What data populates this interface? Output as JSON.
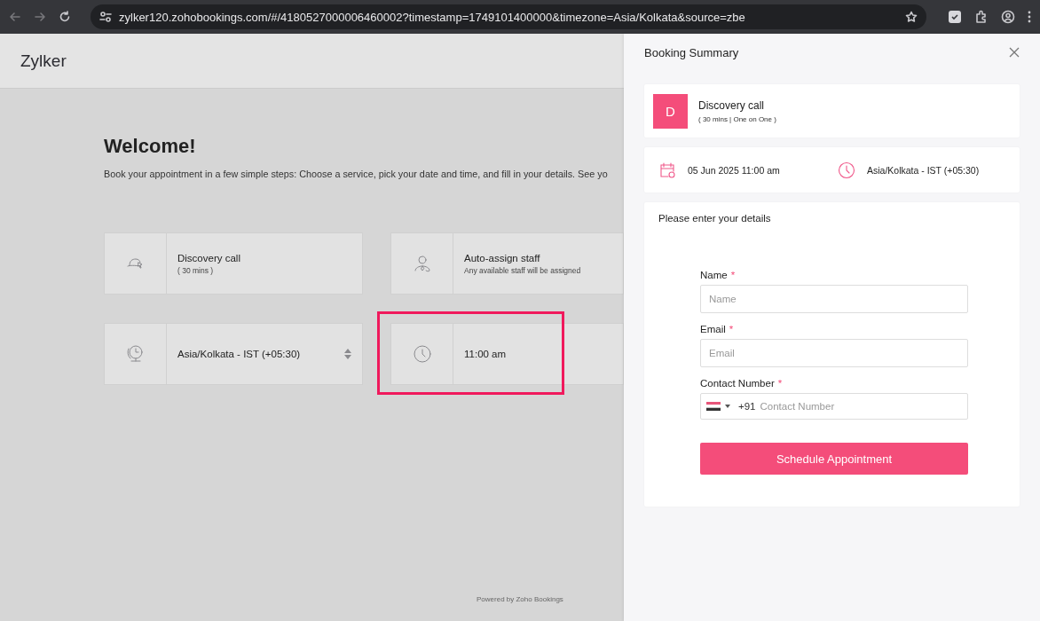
{
  "browser": {
    "url": "zylker120.zohobookings.com/#/4180527000006460002?timestamp=1749101400000&timezone=Asia/Kolkata&source=zbe"
  },
  "page": {
    "brand": "Zylker",
    "heading": "Welcome!",
    "description": "Book your appointment in a few simple steps: Choose a service, pick your date and time, and fill in your details. See yo",
    "cards": [
      {
        "kind": "service",
        "title": "Discovery call",
        "subtitle": "( 30 mins )",
        "highlighted": false
      },
      {
        "kind": "staff",
        "title": "Auto-assign staff",
        "subtitle": "Any available staff will be assigned",
        "highlighted": false
      },
      {
        "kind": "timezone",
        "title": "Asia/Kolkata - IST (+05:30)",
        "highlighted": false
      },
      {
        "kind": "time",
        "title": "11:00 am",
        "highlighted": true
      }
    ],
    "footer": "Powered by Zoho Bookings"
  },
  "summary": {
    "title": "Booking Summary",
    "service": {
      "initial": "D",
      "name": "Discovery call",
      "details": "( 30 mins | One on One )"
    },
    "date": "05 Jun 2025 11:00 am",
    "timezone": "Asia/Kolkata - IST (+05:30)",
    "form_title": "Please enter your details",
    "fields": [
      {
        "kind": "text",
        "label": "Name",
        "required": true,
        "required_mark": "*",
        "placeholder": "Name"
      },
      {
        "kind": "text",
        "label": "Email",
        "required": true,
        "required_mark": "*",
        "placeholder": "Email"
      },
      {
        "kind": "phone",
        "label": "Contact Number",
        "required": true,
        "required_mark": "*",
        "code": "+91",
        "placeholder": "Contact Number"
      }
    ],
    "submit": "Schedule Appointment"
  }
}
